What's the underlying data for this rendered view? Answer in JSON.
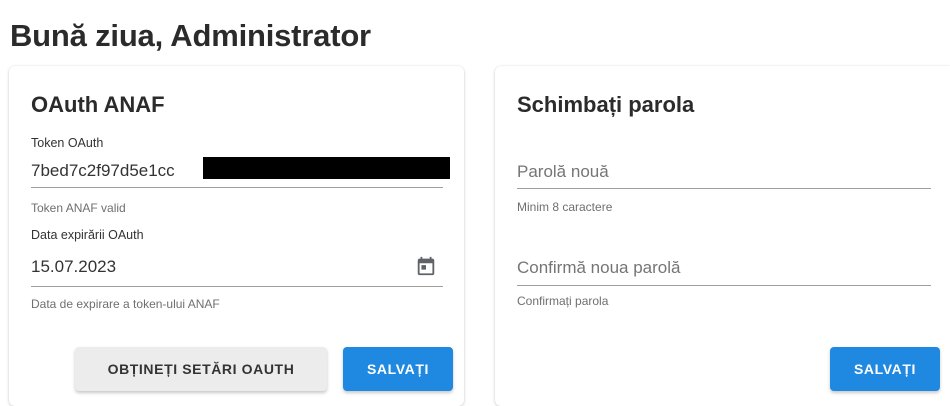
{
  "header": {
    "greeting": "Bună ziua, Administrator"
  },
  "oauth_card": {
    "title": "OAuth ANAF",
    "token_label": "Token OAuth",
    "token_value": "7bed7c2f97d5e1cc",
    "token_hint": "Token ANAF valid",
    "expiry_label": "Data expirării OAuth",
    "expiry_value": "15.07.2023",
    "expiry_hint": "Data de expirare a token-ului ANAF",
    "get_settings_button": "OBȚINEȚI SETĂRI OAUTH",
    "save_button": "SALVAȚI"
  },
  "password_card": {
    "title": "Schimbați parola",
    "new_password_placeholder": "Parolă nouă",
    "new_password_hint": "Minim 8 caractere",
    "confirm_placeholder": "Confirmă noua parolă",
    "confirm_hint": "Confirmați parola",
    "save_button": "SALVAȚI"
  },
  "colors": {
    "primary": "#1f88e0",
    "secondary_button": "#ececec",
    "redaction": "#000000"
  },
  "icons": {
    "date_picker": "calendar-icon"
  }
}
